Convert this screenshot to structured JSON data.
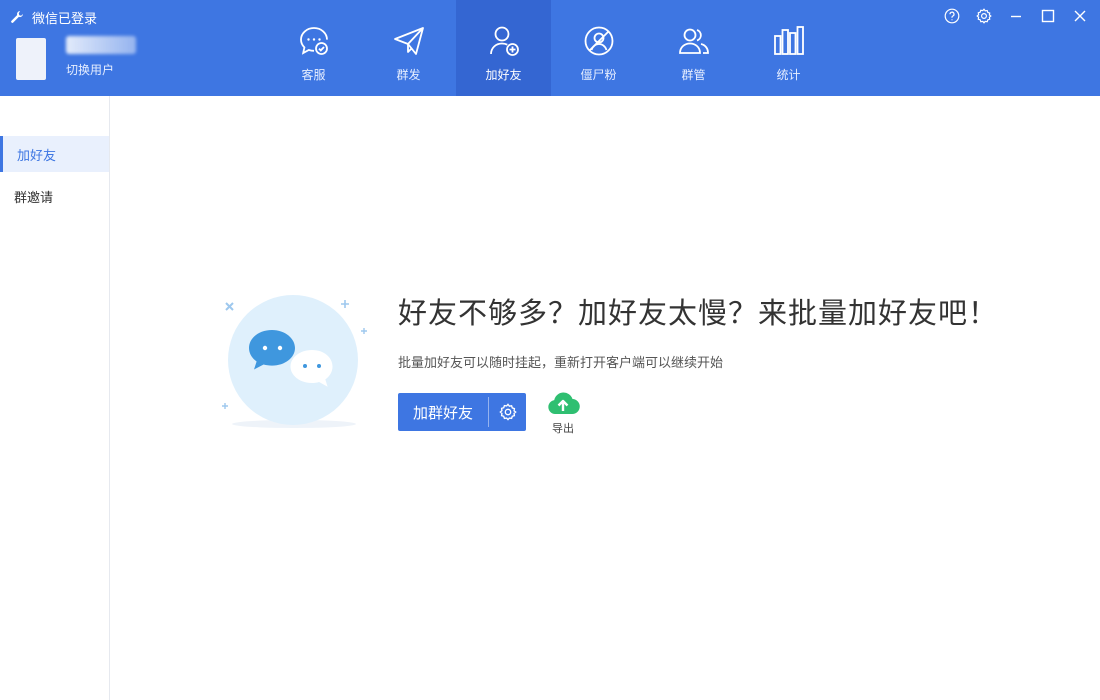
{
  "app": {
    "title": "微信已登录",
    "switch_user_label": "切换用户"
  },
  "nav": {
    "tabs": [
      {
        "label": "客服",
        "icon": "customer-service-icon"
      },
      {
        "label": "群发",
        "icon": "paper-plane-icon"
      },
      {
        "label": "加好友",
        "icon": "add-friend-icon",
        "active": true
      },
      {
        "label": "僵尸粉",
        "icon": "zombie-fan-icon"
      },
      {
        "label": "群管",
        "icon": "group-manage-icon"
      },
      {
        "label": "统计",
        "icon": "bar-chart-icon"
      }
    ]
  },
  "window_controls": [
    "help-icon",
    "settings-icon",
    "minimize-icon",
    "maximize-icon",
    "close-icon"
  ],
  "sidebar": {
    "items": [
      {
        "label": "加好友",
        "active": true
      },
      {
        "label": "群邀请",
        "active": false
      }
    ]
  },
  "main": {
    "title": "好友不够多？加好友太慢？来批量加好友吧！",
    "subtitle": "批量加好友可以随时挂起，重新打开客户端可以继续开始",
    "primary_button_label": "加群好友",
    "export_label": "导出"
  },
  "colors": {
    "accent": "#3e76e2",
    "header_active": "#3466d2",
    "export_green": "#2fbf71"
  }
}
